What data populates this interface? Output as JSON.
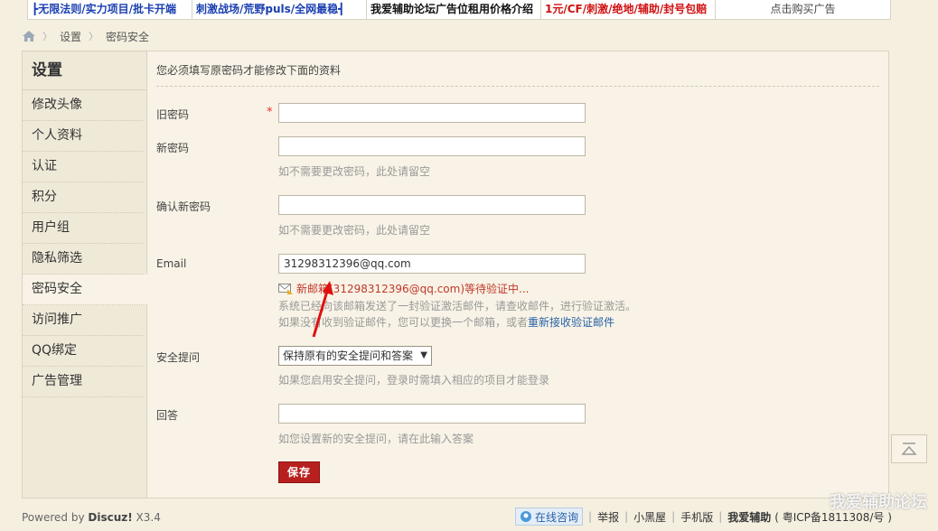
{
  "ads": [
    {
      "text": "┣无限法则/实力项目/批卡开端",
      "color": "#1a3fb0",
      "width": 182
    },
    {
      "text": "刺激战场/荒野puls/全网最稳┫",
      "color": "#1a3fb0",
      "width": 193
    },
    {
      "text": "我爱辅助论坛广告位租用价格介绍",
      "color": "#111111",
      "width": 193
    },
    {
      "text": "1元/CF/刺激/绝地/辅助/封号包赔",
      "color": "#d01010",
      "width": 193
    },
    {
      "text": "点击购买广告",
      "color": "#444444",
      "width": 193
    }
  ],
  "breadcrumb": {
    "home_icon": "home-icon",
    "items": [
      "设置",
      "密码安全"
    ]
  },
  "sidebar": {
    "title": "设置",
    "items": [
      "修改头像",
      "个人资料",
      "认证",
      "积分",
      "用户组",
      "隐私筛选",
      "密码安全",
      "访问推广",
      "QQ绑定",
      "广告管理"
    ],
    "active_index": 6
  },
  "form": {
    "notice": "您必须填写原密码才能修改下面的资料",
    "old_password": {
      "label": "旧密码",
      "required_mark": "*",
      "value": ""
    },
    "new_password": {
      "label": "新密码",
      "value": "",
      "hint": "如不需要更改密码，此处请留空"
    },
    "confirm_password": {
      "label": "确认新密码",
      "value": "",
      "hint": "如不需要更改密码，此处请留空"
    },
    "email": {
      "label": "Email",
      "value": "31298312396@qq.com",
      "verify_text": "新邮箱(31298312396@qq.com)等待验证中...",
      "line1": "系统已经向该邮箱发送了一封验证激活邮件，请查收邮件，进行验证激活。",
      "line2_prefix": "如果没有收到验证邮件，您可以更换一个邮箱，或者",
      "line2_link": "重新接收验证邮件"
    },
    "security_question": {
      "label": "安全提问",
      "selected": "保持原有的安全提问和答案",
      "hint": "如果您启用安全提问，登录时需填入相应的项目才能登录"
    },
    "answer": {
      "label": "回答",
      "value": "",
      "hint": "如您设置新的安全提问，请在此输入答案"
    },
    "save_label": "保存"
  },
  "footer": {
    "powered_prefix": "Powered by ",
    "powered_brand": "Discuz!",
    "powered_version": " X3.4",
    "online_consult": "在线咨询",
    "links": [
      "举报",
      "小黑屋",
      "手机版",
      "我爱辅助"
    ],
    "icp": "( 粤ICP备1811308/号 )"
  },
  "watermark": "我爱辅助论坛"
}
